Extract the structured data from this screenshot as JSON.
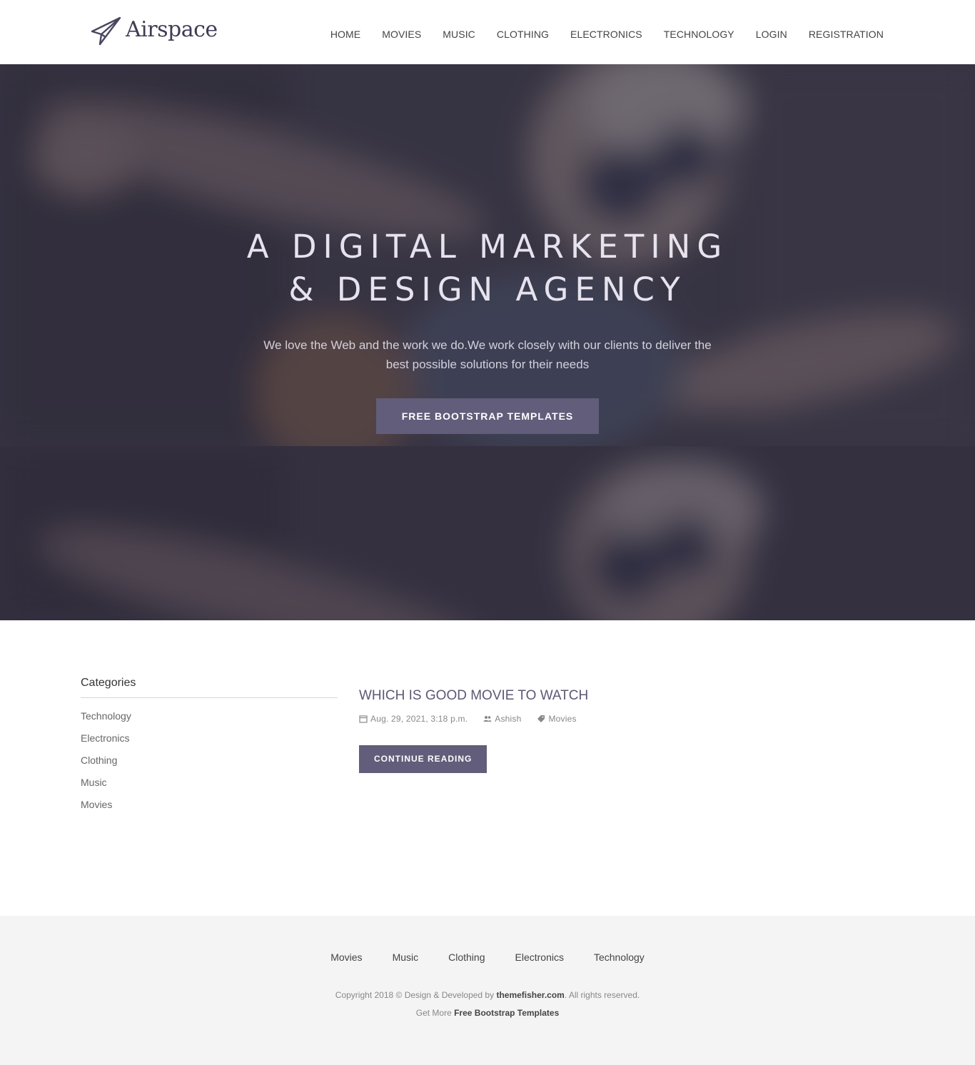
{
  "header": {
    "brand": "Airspace",
    "nav": [
      "HOME",
      "MOVIES",
      "MUSIC",
      "CLOTHING",
      "ELECTRONICS",
      "TECHNOLOGY",
      "LOGIN",
      "REGISTRATION"
    ]
  },
  "hero": {
    "title_line1": "A DIGITAL MARKETING",
    "title_line2": "& DESIGN AGENCY",
    "subtitle": "We love the Web and the work we do.We work closely with our clients to deliver the best possible solutions for their needs",
    "button": "FREE BOOTSTRAP TEMPLATES"
  },
  "sidebar": {
    "title": "Categories",
    "items": [
      "Technology",
      "Electronics",
      "Clothing",
      "Music",
      "Movies"
    ]
  },
  "post": {
    "title": "WHICH IS GOOD MOVIE TO WATCH",
    "date": "Aug. 29, 2021, 3:18 p.m.",
    "author": "Ashish",
    "category": "Movies",
    "button": "CONTINUE READING"
  },
  "footer": {
    "nav": [
      "Movies",
      "Music",
      "Clothing",
      "Electronics",
      "Technology"
    ],
    "copyright_prefix": "Copyright 2018 © Design & Developed by",
    "copyright_link": "themefisher.com",
    "copyright_suffix": ". All rights reserved.",
    "more_prefix": "Get More",
    "more_link": "Free Bootstrap Templates"
  },
  "colors": {
    "accent": "#625d7a",
    "hero_overlay": "#262236",
    "footer_bg": "#f4f4f4"
  }
}
